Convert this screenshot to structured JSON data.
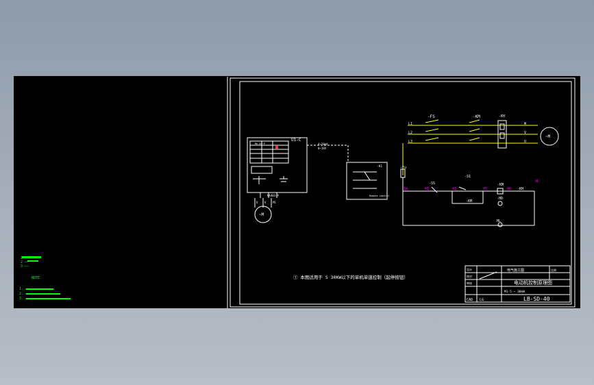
{
  "colors": {
    "background_top": "#8e9bab",
    "canvas": "#000000",
    "line": "#ffffff",
    "power_line": "#ffff00",
    "label": "#ffffff",
    "accent": "#ff00ff",
    "legend": "#00ff00",
    "panel_marker": "#ff3333"
  },
  "power": {
    "phases": [
      "L1",
      "L2",
      "L3"
    ],
    "fuse_switch": "-FS",
    "contactor": "-KM",
    "overload": "-KH",
    "outputs": [
      "W",
      "V",
      "U"
    ],
    "motor": "~M"
  },
  "control": {
    "fuse": "-Fu",
    "wire_start": "1A",
    "wire_nums": [
      "01",
      "03",
      "05",
      "00"
    ],
    "stop_button": "-SS",
    "start_button": "-S1",
    "contactor_coil": "-KM",
    "contactor_aux": "-KM",
    "overload_contact": "-KH",
    "indicator": "-HD",
    "lamp": "HL",
    "end_marker": "N"
  },
  "starter_panel": {
    "title": "U1-C",
    "inner_title": "MA-04~P",
    "footer": "MA403-P",
    "signal": "4~20mA",
    "signal2": "0~10V",
    "marker": "M"
  },
  "plc_box": {
    "title": "-K1",
    "caption": "Remote control"
  },
  "small_motor": {
    "label": "~M",
    "terminals": [
      "U",
      "V",
      "PE"
    ]
  },
  "note": "① 本图适用于 S 30KW以下的单机单速控制（起停按钮）",
  "legend_lines": [
    "1  ——",
    "2  ——",
    "3  ——",
    "NOTE",
    "1.  ———",
    "2.  ———",
    "3.  ————"
  ],
  "title_block": {
    "company": "电气施工图",
    "drawing_title": "电动机控制原理图",
    "sub_title": "M1-5 ~ 30kW",
    "code": "LB-SD-40",
    "rows": [
      "设计",
      "校对",
      "审核",
      "CAD"
    ],
    "scale_label": "比例",
    "sheet": "LG"
  }
}
